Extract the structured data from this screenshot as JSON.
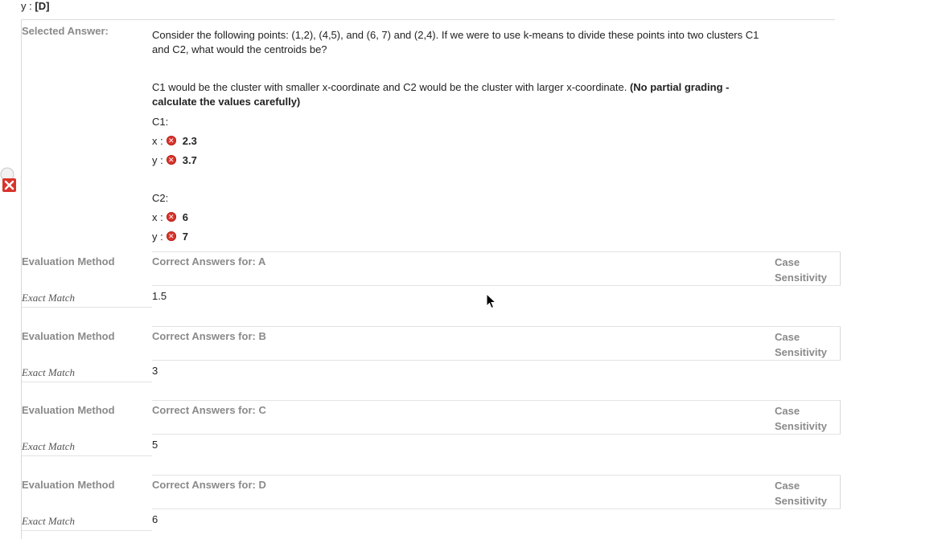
{
  "top": {
    "y_prefix": "y :",
    "y_value": "[D]"
  },
  "selected_answer": {
    "label": "Selected Answer:",
    "question": "Consider the following points: (1,2), (4,5), and (6, 7) and (2,4). If we were to use k-means to divide these points into two clusters C1 and C2, what would the centroids be?",
    "instruction_plain": "C1 would be the cluster with smaller x-coordinate and C2 would be the cluster with larger x-coordinate. ",
    "instruction_bold": "(No partial grading - calculate the values carefully)",
    "c1_label": "C1:",
    "c2_label": "C2:",
    "c1": [
      {
        "label": "x :",
        "value": "2.3"
      },
      {
        "label": "y :",
        "value": "3.7"
      }
    ],
    "c2": [
      {
        "label": "x :",
        "value": "6"
      },
      {
        "label": "y :",
        "value": "7"
      }
    ]
  },
  "rows": [
    {
      "eval_header": "Evaluation Method",
      "correct_header": "Correct Answers for: A",
      "case_header": "Case Sensitivity",
      "method": "Exact Match",
      "answer": "1.5"
    },
    {
      "eval_header": "Evaluation Method",
      "correct_header": "Correct Answers for: B",
      "case_header": "Case Sensitivity",
      "method": "Exact Match",
      "answer": "3"
    },
    {
      "eval_header": "Evaluation Method",
      "correct_header": "Correct Answers for: C",
      "case_header": "Case Sensitivity",
      "method": "Exact Match",
      "answer": "5"
    },
    {
      "eval_header": "Evaluation Method",
      "correct_header": "Correct Answers for: D",
      "case_header": "Case Sensitivity",
      "method": "Exact Match",
      "answer": "6"
    }
  ],
  "colors": {
    "incorrect": "#d9342b",
    "label_gray": "#8a8a8a"
  },
  "icons": {
    "incorrect": "incorrect-x-icon",
    "side": "incorrect-question-icon",
    "cursor": "mouse-cursor-icon"
  }
}
